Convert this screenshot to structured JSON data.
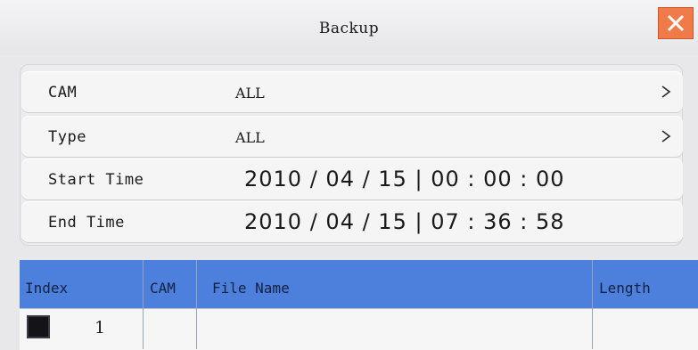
{
  "window": {
    "title": "Backup"
  },
  "colors": {
    "accent_header": "#4d7fdd",
    "close_button": "#f07a48"
  },
  "form": {
    "cam": {
      "label": "CAM",
      "value": "ALL"
    },
    "type": {
      "label": "Type",
      "value": "ALL"
    },
    "start_time": {
      "label": "Start Time",
      "value": "2010 / 04 / 15 | 00 : 00 : 00"
    },
    "end_time": {
      "label": "End Time",
      "value": "2010 / 04 / 15 | 07 : 36 : 58"
    }
  },
  "table": {
    "columns": [
      "Index",
      "CAM",
      "File Name",
      "Length"
    ],
    "rows": [
      {
        "index": "1",
        "cam": "",
        "file_name": "",
        "length": ""
      }
    ]
  }
}
